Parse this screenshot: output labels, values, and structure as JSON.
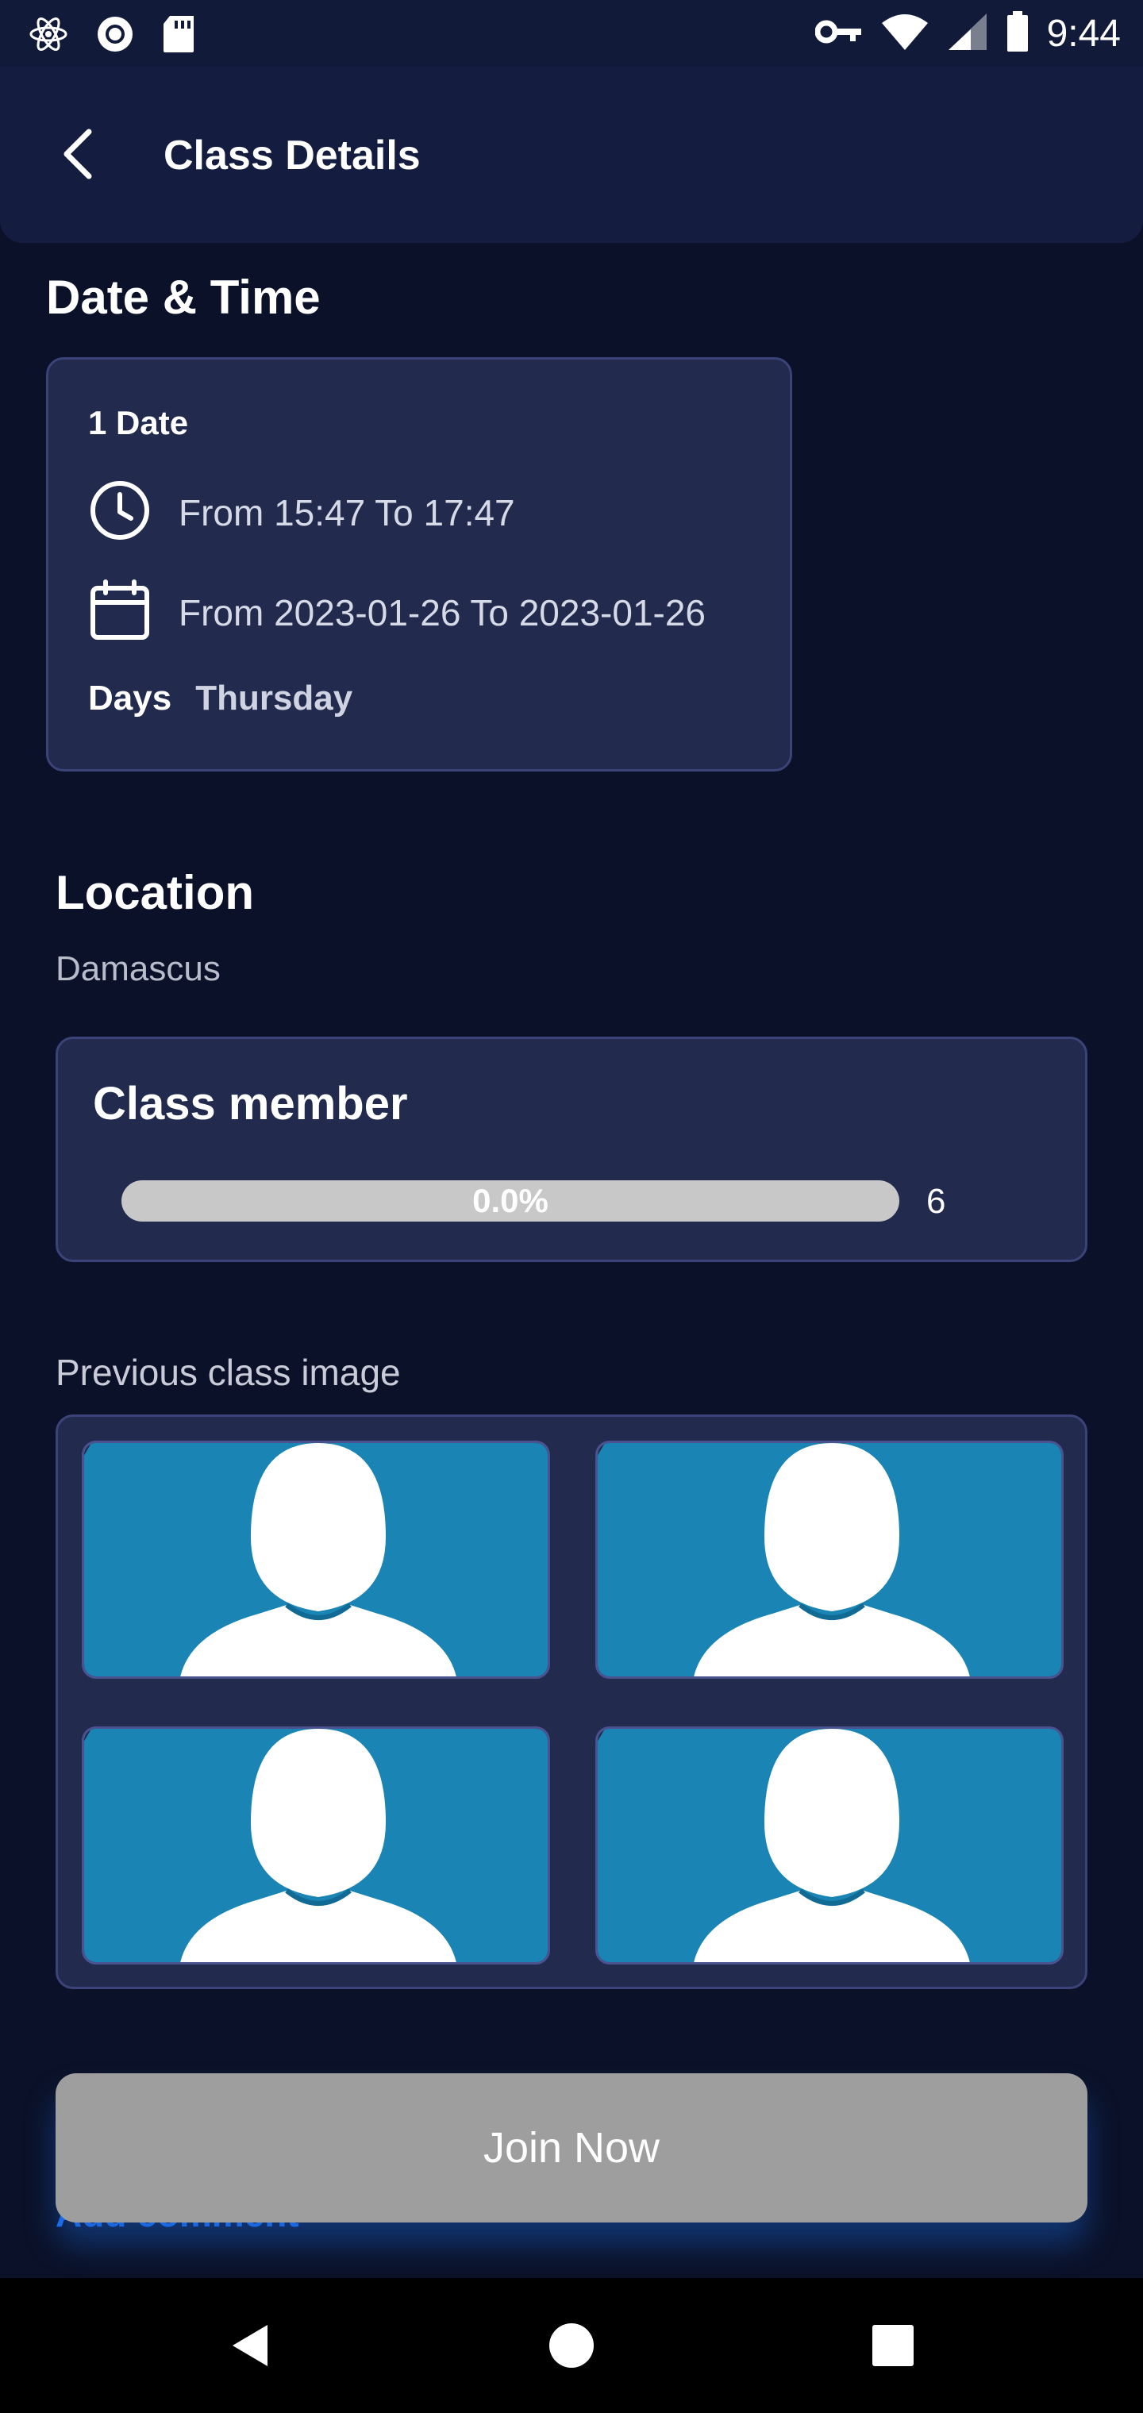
{
  "status_bar": {
    "time": "9:44",
    "icons": [
      "react-icon",
      "radio-icon",
      "sd-card-icon",
      "key-icon",
      "wifi-icon",
      "signal-icon",
      "battery-icon"
    ]
  },
  "app_bar": {
    "title": "Class Details",
    "back_icon": "chevron-left-icon"
  },
  "date_time": {
    "section_title": "Date & Time",
    "date_label": "1 Date",
    "time_range": "From 15:47  To 17:47",
    "date_range": "From 2023-01-26  To 2023-01-26",
    "days_label": "Days",
    "days_value": "Thursday"
  },
  "location": {
    "section_title": "Location",
    "value": "Damascus"
  },
  "class_member": {
    "title": "Class member",
    "progress_text": "0.0%",
    "progress_fraction": 0.0,
    "count": "6"
  },
  "previous_images": {
    "label": "Previous class image",
    "count": 4
  },
  "actions": {
    "join_label": "Join Now",
    "add_comment_label": "Add comment"
  },
  "colors": {
    "background": "#0b1128",
    "card": "#222a4e",
    "card_border": "#3a4478",
    "avatar_bg": "#1a84b4",
    "join_disabled": "#9e9e9e",
    "link": "#1e6ff0"
  }
}
